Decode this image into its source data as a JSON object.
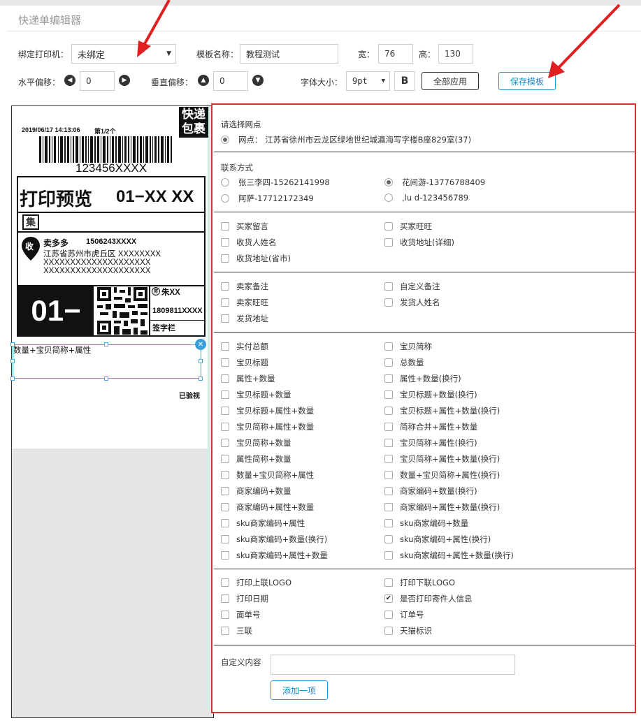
{
  "header": {
    "title": "快递单编辑器"
  },
  "toolbar": {
    "printer_label": "绑定打印机：",
    "printer_value": "未绑定",
    "template_name_label": "模板名称：",
    "template_name_value": "教程测试",
    "width_label": "宽：",
    "width_value": "76",
    "height_label": "高：",
    "height_value": "130",
    "hoffset_label": "水平偏移：",
    "hoffset_value": "0",
    "voffset_label": "垂直偏移：",
    "voffset_value": "0",
    "font_size_label": "字体大小：",
    "font_size_value": "9pt",
    "bold_label": "B",
    "apply_all_label": "全部应用",
    "save_label": "保存模板"
  },
  "preview": {
    "datetime": "2019/06/17   14:13:06",
    "page": "第1/2个",
    "badge_line1": "快递",
    "badge_line2": "包裹",
    "barcode_text": "123456XXXX",
    "print_title": "打印预览",
    "print_code": "01−XX XX",
    "collect_badge": "集",
    "receiver_icon": "收",
    "receiver_name": "卖多多",
    "receiver_phone": "1506243XXXX",
    "addr1": "江苏省苏州市虎丘区 XXXXXXXX",
    "addr2": "XXXXXXXXXXXXXXXXXXXX",
    "addr3": "XXXXXXXXXXXXXXXXXXXX",
    "big_code": "01−",
    "sender_name": "朱XX",
    "sender_phone": "1809811XXXX",
    "sign_label": "签字栏",
    "selected_field": "数量+宝贝简称+属性",
    "inspected": "已验视"
  },
  "panel": {
    "outlet_title": "请选择网点",
    "outlet_option": "网点：  江苏省徐州市云龙区绿地世纪城瀛海写字楼B座829室(37)",
    "contact_title": "联系方式",
    "contacts": [
      {
        "label": "张三李四-15262141998",
        "checked": false
      },
      {
        "label": "花间游-13776788409",
        "checked": true
      },
      {
        "label": "阿萨-17712172349",
        "checked": false
      },
      {
        "label": ",lu d-123456789",
        "checked": false
      }
    ],
    "group1": [
      "买家留言",
      "买家旺旺",
      "收货人姓名",
      "收货地址(详细)",
      "收货地址(省市)"
    ],
    "group2": [
      "卖家备注",
      "自定义备注",
      "卖家旺旺",
      "发货人姓名",
      "发货地址"
    ],
    "group3": [
      "实付总额",
      "宝贝简称",
      "宝贝标题",
      "总数量",
      "属性+数量",
      "属性+数量(换行)",
      "宝贝标题+数量",
      "宝贝标题+数量(换行)",
      "宝贝标题+属性+数量",
      "宝贝标题+属性+数量(换行)",
      "宝贝简称+属性+数量",
      "简称合并+属性+数量",
      "宝贝简称+数量",
      "宝贝简称+属性(换行)",
      "属性简称+数量",
      "宝贝简称+属性+数量(换行)",
      "数量+宝贝简称+属性",
      "数量+宝贝简称+属性(换行)",
      "商家编码+数量",
      "商家编码+数量(换行)",
      "商家编码+属性+数量",
      "商家编码+属性+数量(换行)",
      "sku商家编码+属性",
      "sku商家编码+数量",
      "sku商家编码+数量(换行)",
      "sku商家编码+属性(换行)",
      "sku商家编码+属性+数量",
      "sku商家编码+属性+数量(换行)"
    ],
    "group4": [
      {
        "label": "打印上联LOGO",
        "checked": false
      },
      {
        "label": "打印下联LOGO",
        "checked": false
      },
      {
        "label": "打印日期",
        "checked": false
      },
      {
        "label": "是否打印寄件人信息",
        "checked": true
      },
      {
        "label": "面单号",
        "checked": false
      },
      {
        "label": "订单号",
        "checked": false
      },
      {
        "label": "三联",
        "checked": false
      },
      {
        "label": "天猫标识",
        "checked": false
      }
    ],
    "custom_label": "自定义内容",
    "custom_value": "",
    "add_label": "添加一项"
  },
  "colors": {
    "annotation_red": "#e02020",
    "accent_blue": "#2196d3"
  }
}
